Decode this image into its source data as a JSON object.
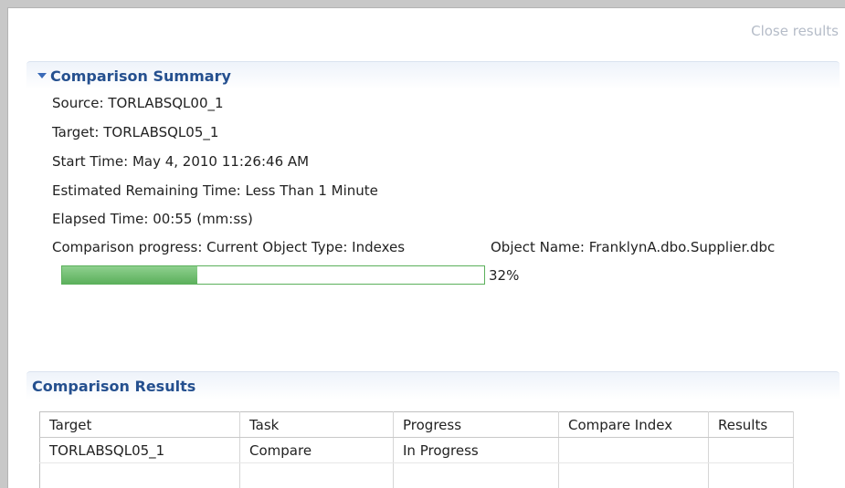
{
  "close_label": "Close results",
  "summary": {
    "title": "Comparison Summary",
    "source": "Source: TORLABSQL00_1",
    "target": "Target: TORLABSQL05_1",
    "start_time": "Start Time: May 4, 2010 11:26:46 AM",
    "remaining": "Estimated Remaining Time: Less Than 1 Minute",
    "elapsed": "Elapsed Time: 00:55 (mm:ss)",
    "progress_text": "Comparison progress: Current Object Type: Indexes",
    "object_name": "Object Name: FranklynA.dbo.Supplier.dbc",
    "progress_value": 32,
    "progress_label": "32%"
  },
  "results": {
    "title": "Comparison Results",
    "columns": [
      "Target",
      "Task",
      "Progress",
      "Compare Index",
      "Results"
    ],
    "rows": [
      [
        "TORLABSQL05_1",
        "Compare",
        "In Progress",
        "",
        ""
      ]
    ]
  },
  "colors": {
    "header_text": "#25508f",
    "progress_fill": "#5cb05c",
    "close_link": "#b5bcc8"
  }
}
